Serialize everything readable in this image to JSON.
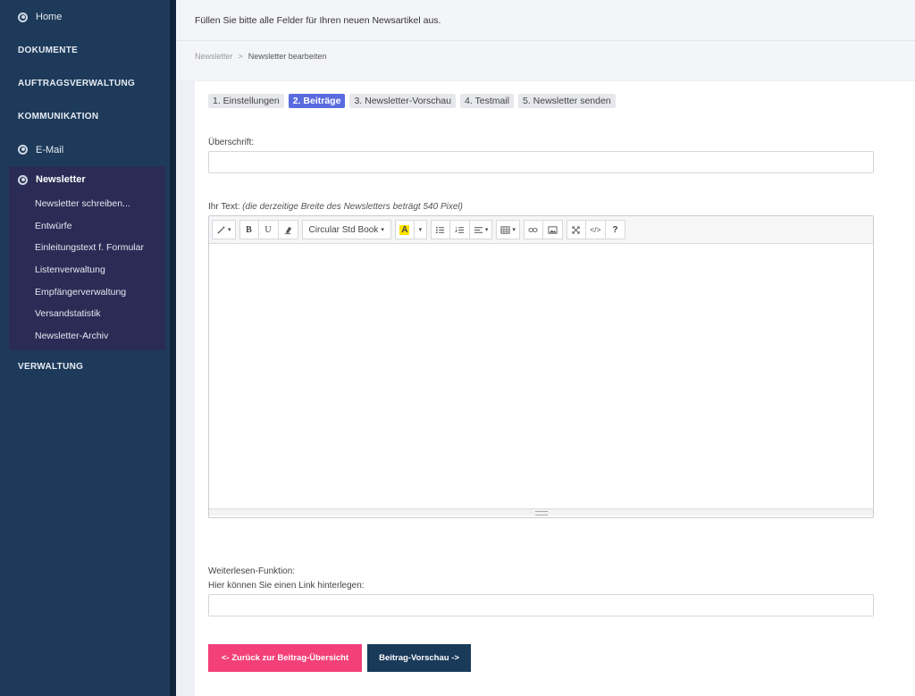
{
  "sidebar": {
    "home": "Home",
    "dokumente": "DOKUMENTE",
    "auftragsverwaltung": "AUFTRAGSVERWALTUNG",
    "kommunikation": "KOMMUNIKATION",
    "email": "E-Mail",
    "newsletter": "Newsletter",
    "sub": [
      "Newsletter schreiben...",
      "Entwürfe",
      "Einleitungstext f. Formular",
      "Listenverwaltung",
      "Empfängerverwaltung",
      "Versandstatistik",
      "Newsletter-Archiv"
    ],
    "verwaltung": "VERWALTUNG"
  },
  "header": {
    "instruction": "Füllen Sie bitte alle Felder für Ihren neuen Newsartikel aus."
  },
  "breadcrumb": {
    "parent": "Newsletter",
    "separator": ">",
    "current": "Newsletter bearbeiten"
  },
  "steps": [
    "1. Einstellungen",
    "2. Beiträge",
    "3. Newsletter-Vorschau",
    "4. Testmail",
    "5. Newsletter senden"
  ],
  "form": {
    "heading_label": "Überschrift:",
    "text_label": "Ihr Text:",
    "text_hint": "(die derzeitige Breite des Newsletters beträgt 540 Pixel)",
    "readmore_label": "Weiterlesen-Funktion:",
    "link_label": "Hier können Sie einen Link hinterlegen:"
  },
  "toolbar": {
    "bold": "B",
    "underline": "U",
    "font": "Circular Std Book",
    "color_letter": "A",
    "help": "?",
    "code": "</>"
  },
  "buttons": {
    "back": "<- Zurück zur Beitrag-Übersicht",
    "preview": "Beitrag-Vorschau ->"
  },
  "colors": {
    "sidebar": "#1e3a5a",
    "active_step": "#5a6be0",
    "back_button": "#f3407a",
    "next_button": "#1a3a5a"
  }
}
